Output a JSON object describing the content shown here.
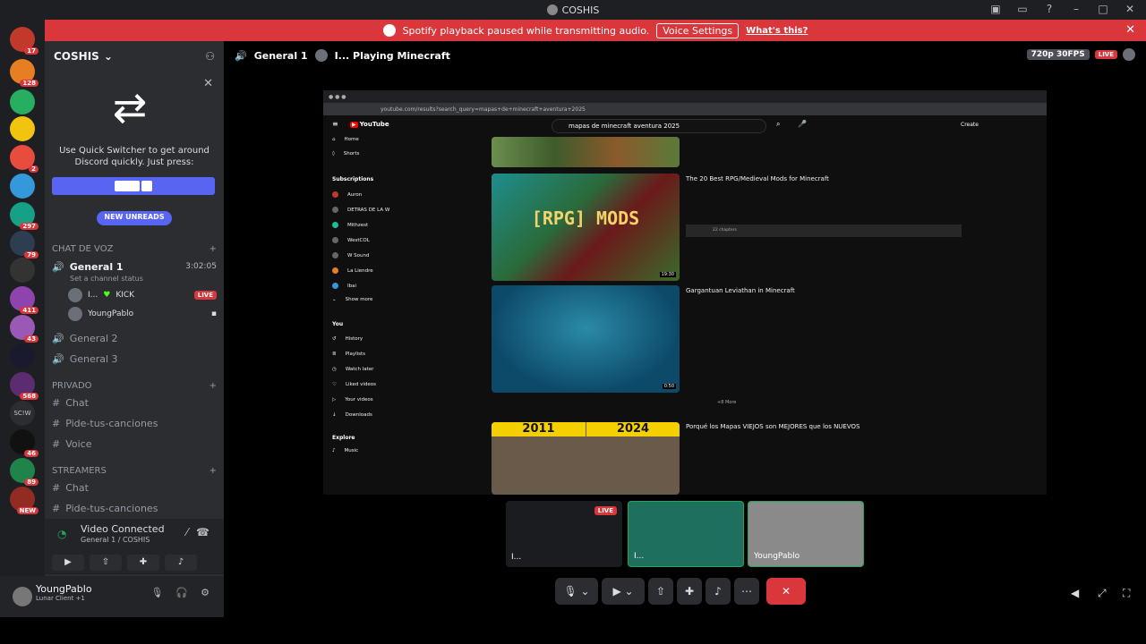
{
  "window": {
    "title": "COSHIS"
  },
  "banner": {
    "message": "Spotify playback paused while transmitting audio.",
    "button": "Voice Settings",
    "link": "What's this?"
  },
  "guild_badges": [
    "17",
    "128",
    "2",
    "297",
    "79",
    "411",
    "43",
    "568",
    "SC!W",
    "46",
    "89",
    "NEW"
  ],
  "server": {
    "name": "COSHIS"
  },
  "quick_switcher": {
    "text": "Use Quick Switcher to get around Discord quickly. Just press:"
  },
  "new_unreads": "NEW UNREADS",
  "categories": {
    "voice": "CHAT DE VOZ",
    "private": "PRIVADO",
    "streamers": "STREAMERS"
  },
  "voice_channels": [
    {
      "name": "General 1",
      "timer": "3:02:05",
      "status": "Set a channel status"
    },
    {
      "name": "General 2"
    },
    {
      "name": "General 3"
    }
  ],
  "voice_users": [
    {
      "name": "I...",
      "tag": "KICK",
      "live": "LIVE"
    },
    {
      "name": "YoungPablo"
    }
  ],
  "private_channels": [
    "Chat",
    "Pide-tus-canciones",
    "Voice"
  ],
  "streamer_channels": [
    "Chat",
    "Pide-tus-canciones"
  ],
  "voice_connection": {
    "status": "Video Connected",
    "channel": "General 1 / COSHIS"
  },
  "user_panel": {
    "name": "YoungPablo",
    "status": "Lunar Client +1"
  },
  "stage": {
    "channel": "General 1",
    "activity": "I... Playing Minecraft",
    "quality": "720p 30FPS",
    "live": "LIVE"
  },
  "youtube": {
    "search": "mapas de minecraft aventura 2025",
    "address": "youtube.com/results?search_query=mapas+de+minecraft+aventura+2025",
    "create": "Create",
    "side": {
      "top": [
        "Home",
        "Shorts"
      ],
      "subs_header": "Subscriptions",
      "subs": [
        "Auron",
        "DETRAS DE LA W",
        "Mithzest",
        "WestCOL",
        "W Sound",
        "La Liendre",
        "Ibai"
      ],
      "show_more": "Show more",
      "you_header": "You",
      "you": [
        "History",
        "Playlists",
        "Watch later",
        "Liked videos",
        "Your videos",
        "Downloads"
      ],
      "explore_header": "Explore",
      "explore": [
        "Music"
      ]
    },
    "videos": [
      {
        "title": "The 20 Best RPG/Medieval Mods for Minecraft",
        "thumb_text": "[RPG] MODS",
        "duration": "19:30",
        "chapters": "22 chapters"
      },
      {
        "title": "Gargantuan Leviathan in Minecraft",
        "duration": "0:50",
        "more": "+8 More"
      },
      {
        "title": "Porqué los Mapas VIEJOS son MEJORES que los NUEVOS",
        "year_left": "2011",
        "year_right": "2024"
      }
    ]
  },
  "tiles": [
    {
      "name": "I...",
      "live": "LIVE"
    },
    {
      "name": "I..."
    },
    {
      "name": "YoungPablo"
    }
  ]
}
